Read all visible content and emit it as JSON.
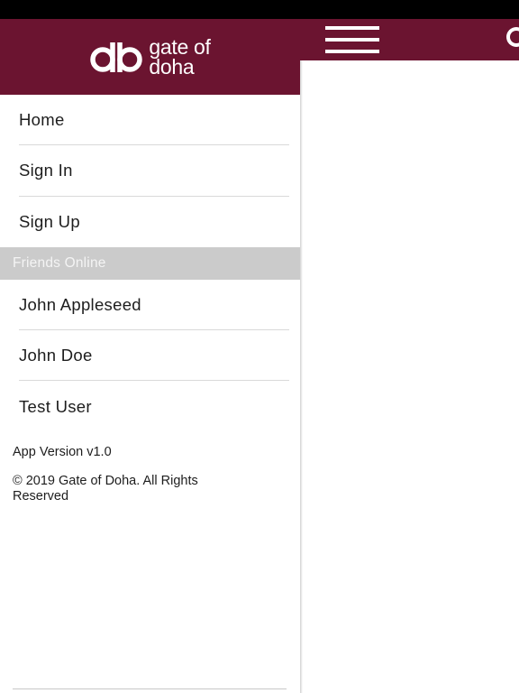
{
  "brand": {
    "line1": "gate of",
    "line2": "doha",
    "color": "#6b1430"
  },
  "menu": {
    "items": [
      {
        "label": "Home"
      },
      {
        "label": "Sign In"
      },
      {
        "label": "Sign Up"
      }
    ]
  },
  "friends": {
    "header": "Friends Online",
    "items": [
      {
        "label": "John Appleseed"
      },
      {
        "label": "John Doe"
      },
      {
        "label": "Test User"
      }
    ]
  },
  "footer": {
    "version": "App Version v1.0",
    "copyright": "© 2019 Gate of Doha. All Rights Reserved"
  },
  "icons": {
    "menu": "hamburger-menu-icon",
    "logo": "gate-of-doha-logo"
  }
}
